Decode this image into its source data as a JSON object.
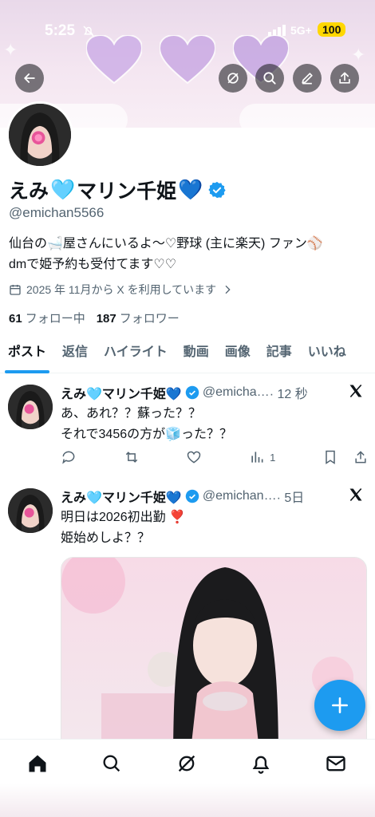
{
  "status": {
    "time": "5:25",
    "network": "5G+",
    "battery": "100"
  },
  "header": {
    "back_icon": "arrow-left-icon",
    "grok_icon": "grok-icon",
    "search_icon": "search-icon",
    "edit_icon": "pencil-icon",
    "share_icon": "share-icon"
  },
  "profile": {
    "name_prefix": "えみ",
    "name_heart1": "🩵",
    "name_main": "マリン千姫",
    "name_heart2": "💙",
    "handle": "@emichan5566",
    "bio_line1": "仙台の🛁屋さんにいるよ〜♡野球 (主に楽天) ファン⚾",
    "bio_line2": "dmで姫予約も受付てます♡♡",
    "joined": "2025 年 11月から X を利用しています",
    "following_count": "61",
    "following_label": "フォロー中",
    "followers_count": "187",
    "followers_label": "フォロワー"
  },
  "tabs": [
    "ポスト",
    "返信",
    "ハイライト",
    "動画",
    "画像",
    "記事",
    "いいね"
  ],
  "posts": [
    {
      "name": "えみ🩵マリン千姫💙",
      "handle": "@emicha…",
      "time": "· 12 秒",
      "line1": "あ、あれ？？蘇った？？",
      "line2": "それで3456の方が🧊った？？",
      "views": "1"
    },
    {
      "name": "えみ🩵マリン千姫💙",
      "handle": "@emichan…",
      "time": "· 5日",
      "line1": "明日は2026初出勤 ❣️",
      "line2": "姫始めしよ？？"
    }
  ],
  "fab_icon": "plus-icon",
  "bottom_nav": [
    "home-icon",
    "search-icon",
    "grok-icon",
    "bell-icon",
    "mail-icon"
  ],
  "colors": {
    "accent": "#1d9bf0",
    "text": "#0f1419",
    "muted": "#536471"
  }
}
